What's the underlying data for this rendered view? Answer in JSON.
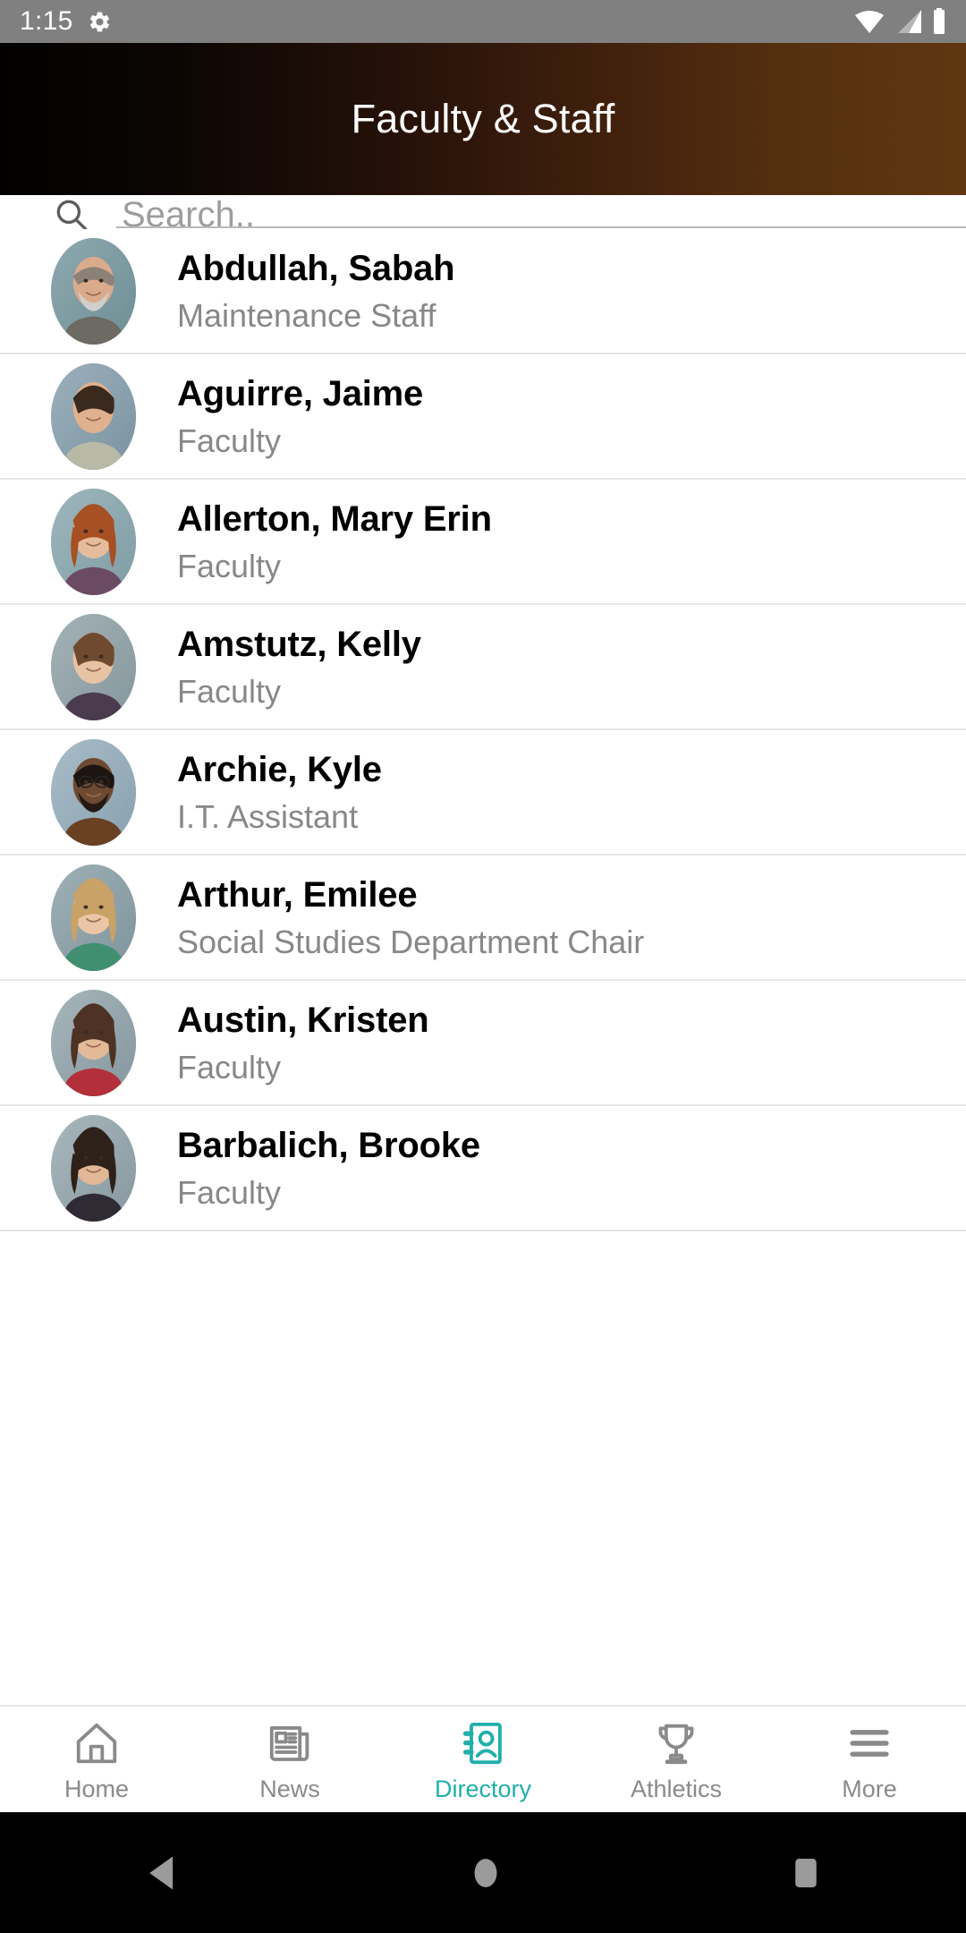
{
  "status_bar": {
    "time": "1:15",
    "icons": [
      "gear-icon",
      "wifi-icon",
      "cellular-signal-icon",
      "battery-icon"
    ]
  },
  "header": {
    "title": "Faculty & Staff",
    "gradient_from": "#020100",
    "gradient_to": "#5f3610"
  },
  "search": {
    "placeholder": "Search..",
    "value": "",
    "icon": "search-icon"
  },
  "directory": {
    "entries": [
      {
        "name": "Abdullah, Sabah",
        "title": "Maintenance Staff",
        "avatar": "male-older-gray-shirt"
      },
      {
        "name": "Aguirre, Jaime",
        "title": "Faculty",
        "avatar": "male-young-checked-shirt"
      },
      {
        "name": "Allerton, Mary Erin",
        "title": "Faculty",
        "avatar": "female-red-hair-striped-top"
      },
      {
        "name": "Amstutz, Kelly",
        "title": "Faculty",
        "avatar": "female-short-hair-patterned-top"
      },
      {
        "name": "Archie, Kyle",
        "title": "I.T. Assistant",
        "avatar": "male-glasses-brown-shirt"
      },
      {
        "name": "Arthur, Emilee",
        "title": "Social Studies Department Chair",
        "avatar": "female-blonde-green-top"
      },
      {
        "name": "Austin, Kristen",
        "title": "Faculty",
        "avatar": "female-brown-hair-red-top"
      },
      {
        "name": "Barbalich, Brooke",
        "title": "Faculty",
        "avatar": "female-long-dark-hair"
      }
    ]
  },
  "tabbar": {
    "active_color": "#20AFA9",
    "inactive_color": "#8a8a8a",
    "tabs": [
      {
        "label": "Home",
        "icon": "home-icon",
        "active": false
      },
      {
        "label": "News",
        "icon": "news-icon",
        "active": false
      },
      {
        "label": "Directory",
        "icon": "directory-icon",
        "active": true
      },
      {
        "label": "Athletics",
        "icon": "trophy-icon",
        "active": false
      },
      {
        "label": "More",
        "icon": "menu-icon",
        "active": false
      }
    ]
  },
  "system_nav": {
    "buttons": [
      "back-button",
      "home-button",
      "recents-button"
    ]
  }
}
